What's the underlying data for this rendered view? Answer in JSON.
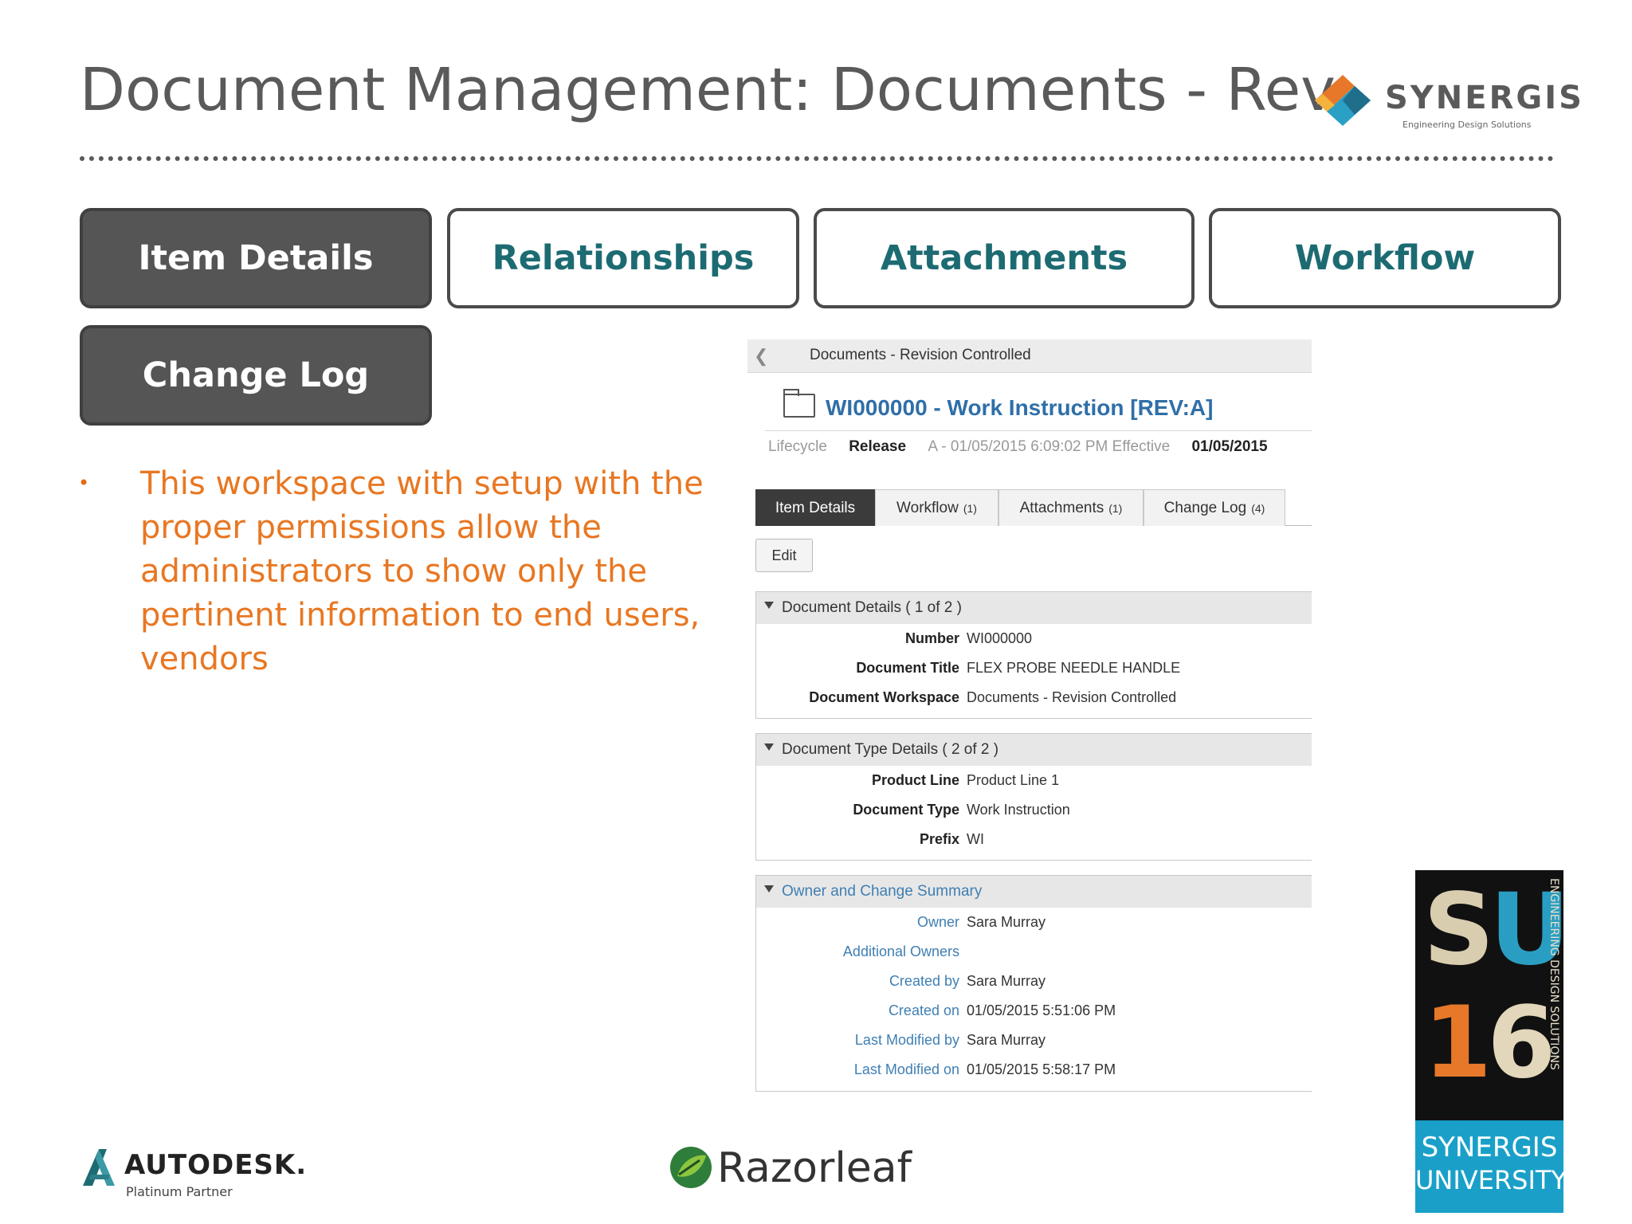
{
  "slide": {
    "title": "Document Management: Documents - Rev",
    "brand": {
      "name": "SYNERGIS",
      "tagline": "Engineering Design Solutions"
    }
  },
  "nav_buttons": [
    {
      "label": "Item Details",
      "style": "dark"
    },
    {
      "label": "Relationships",
      "style": "light"
    },
    {
      "label": "Attachments",
      "style": "light"
    },
    {
      "label": "Workflow",
      "style": "light"
    },
    {
      "label": "Change Log",
      "style": "dark"
    }
  ],
  "bullet": {
    "text": "This workspace with setup with the proper permissions allow the administrators to show only the pertinent information to end users, vendors"
  },
  "app": {
    "workspace": "Documents - Revision Controlled",
    "item_title": "WI000000 - Work Instruction [REV:A]",
    "lifecycle": {
      "label": "Lifecycle",
      "value": "Release",
      "state": "A - 01/05/2015 6:09:02 PM Effective",
      "effective_date": "01/05/2015"
    },
    "tabs": [
      {
        "label": "Item Details",
        "count": "",
        "active": true
      },
      {
        "label": "Workflow",
        "count": "(1)",
        "active": false
      },
      {
        "label": "Attachments",
        "count": "(1)",
        "active": false
      },
      {
        "label": "Change Log",
        "count": "(4)",
        "active": false
      }
    ],
    "edit_label": "Edit",
    "sections": {
      "document_details": {
        "title": "Document Details ( 1 of 2 )",
        "fields": [
          {
            "label": "Number",
            "value": "WI000000"
          },
          {
            "label": "Document Title",
            "value": "FLEX PROBE NEEDLE HANDLE"
          },
          {
            "label": "Document Workspace",
            "value": "Documents - Revision Controlled"
          }
        ]
      },
      "document_type": {
        "title": "Document Type Details ( 2 of 2 )",
        "fields": [
          {
            "label": "Product Line",
            "value": "Product Line 1"
          },
          {
            "label": "Document Type",
            "value": "Work Instruction"
          },
          {
            "label": "Prefix",
            "value": "WI"
          }
        ]
      },
      "owner_summary": {
        "title": "Owner and Change Summary",
        "fields": [
          {
            "label": "Owner",
            "value": "Sara Murray"
          },
          {
            "label": "Additional Owners",
            "value": ""
          },
          {
            "label": "Created by",
            "value": "Sara Murray"
          },
          {
            "label": "Created on",
            "value": "01/05/2015 5:51:06 PM"
          },
          {
            "label": "Last Modified by",
            "value": "Sara Murray"
          },
          {
            "label": "Last Modified on",
            "value": "01/05/2015 5:58:17 PM"
          }
        ]
      }
    }
  },
  "footer": {
    "autodesk": {
      "name": "AUTODESK.",
      "sub": "Platinum Partner"
    },
    "razorleaf": {
      "name": "Razorleaf"
    },
    "badge": {
      "letters_top": [
        "S",
        "U"
      ],
      "letters_bottom": [
        "1",
        "6"
      ],
      "vertical": "ENGINEERING DESIGN SOLUTIONS",
      "line1": "SYNERGIS",
      "line2": "UNIVERSITY"
    }
  },
  "colors": {
    "title": "#5a5a5a",
    "nav_dark": "#555555",
    "nav_light_text": "#1d6b72",
    "bullet": "#e87722",
    "link_blue": "#2f6fa8",
    "badge_blue": "#1aa0c8"
  }
}
